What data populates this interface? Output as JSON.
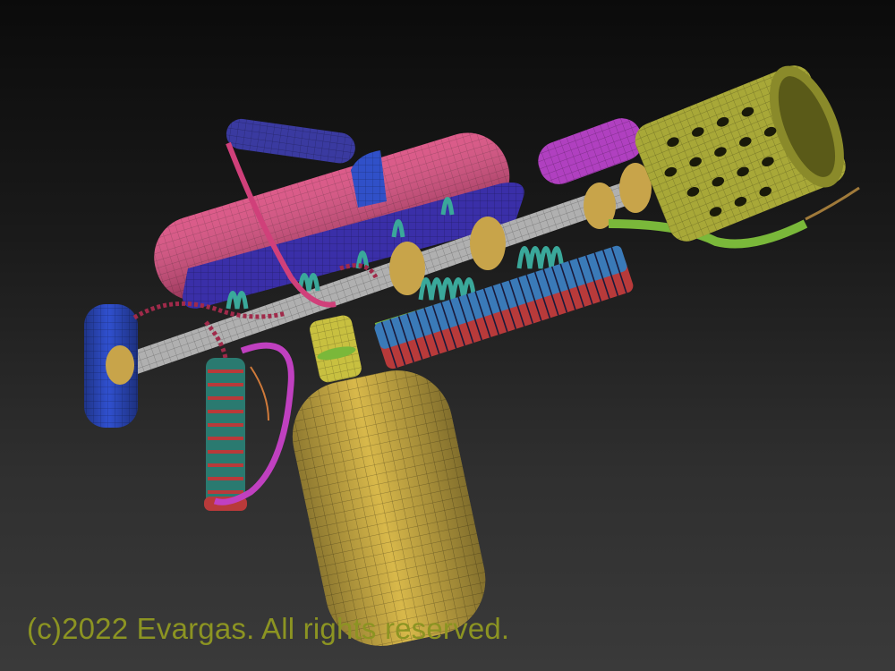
{
  "image": {
    "subject": "wireframe-blaster",
    "copyright": "(c)2022 Evargas. All rights reserved."
  },
  "colors": {
    "background_top": "#0b0b0b",
    "background_bottom": "#3a3a3a",
    "caption": "#8c9422",
    "tank_pink": "#d8457a",
    "body_blue": "#3a2fa8",
    "canister_yellow": "#d8b84a",
    "muzzle_olive": "#a8a838",
    "coil_teal": "#3aa89a",
    "hose_magenta": "#c040c0",
    "rod_gray": "#b0b0b0",
    "fin_blue": "#3a7ab8",
    "fin_red": "#b83a3a",
    "ring_gold": "#c8a44a",
    "pipe_green": "#7ab83a",
    "grip_blue": "#3050d0"
  }
}
